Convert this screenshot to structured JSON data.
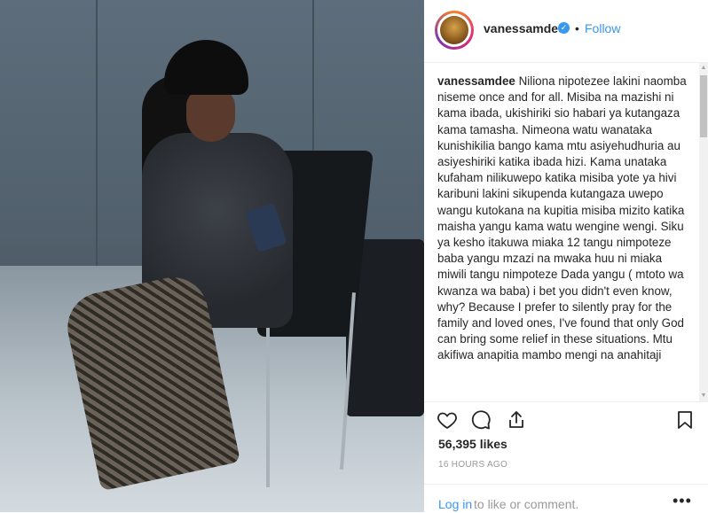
{
  "post": {
    "username": "vanessamdee",
    "verified_icon": "verified-badge-icon",
    "separator": "•",
    "follow_label": "Follow",
    "caption_user": "vanessamdee",
    "caption_text": "Niliona nipotezee lakini naomba niseme once and for all. Misiba na mazishi ni kama ibada, ukishiriki sio habari ya kutangaza kama tamasha. Nimeona watu wanataka kunishikilia bango kama mtu asiyehudhuria au asiyeshiriki katika ibada hizi. Kama unataka kufaham nilikuwepo katika misiba yote ya hivi karibuni lakini sikupenda kutangaza uwepo wangu kutokana na kupitia misiba mizito katika maisha yangu kama watu wengine wengi. Siku ya kesho itakuwa miaka 12 tangu nimpoteze baba yangu mzazi na mwaka huu ni miaka miwili tangu nimpoteze Dada yangu ( mtoto wa kwanza wa baba) i bet you didn't even know, why? Because I prefer to silently pray for the family and loved ones, I've found that only God can bring some relief in these situations. Mtu akifiwa anapitia mambo mengi na anahitaji",
    "likes": "56,395 likes",
    "timestamp": "16 HOURS AGO",
    "login_label": "Log in",
    "login_rest": " to like or comment.",
    "more_label": "•••"
  },
  "icons": {
    "like": "heart-icon",
    "comment": "comment-icon",
    "share": "share-icon",
    "save": "bookmark-icon"
  },
  "colors": {
    "link": "#3897f0",
    "text": "#262626",
    "muted": "#999999",
    "verified": "#3897f0"
  }
}
